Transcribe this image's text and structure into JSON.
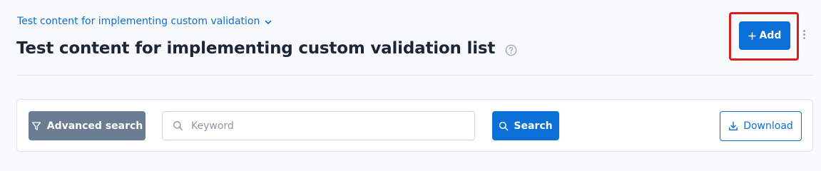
{
  "header": {
    "breadcrumb": "Test content for implementing custom validation",
    "title": "Test content for implementing custom validation list"
  },
  "toolbar": {
    "add_label": "Add"
  },
  "filters": {
    "advanced_search_label": "Advanced search",
    "keyword_placeholder": "Keyword",
    "keyword_value": "",
    "search_label": "Search",
    "download_label": "Download"
  },
  "icons": {
    "breadcrumb": "chevron-down-icon",
    "title": "help-icon",
    "add": "plus-icon",
    "menu": "kebab-menu-icon",
    "advanced_search": "filter-icon",
    "keyword": "search-icon",
    "search": "search-icon",
    "download": "download-icon"
  },
  "colors": {
    "primary": "#0b6fd8",
    "highlight": "#dd1c1c",
    "secondary_button": "#6a7d92",
    "title_text": "#1b2637",
    "page_background": "#f7f9fc"
  }
}
